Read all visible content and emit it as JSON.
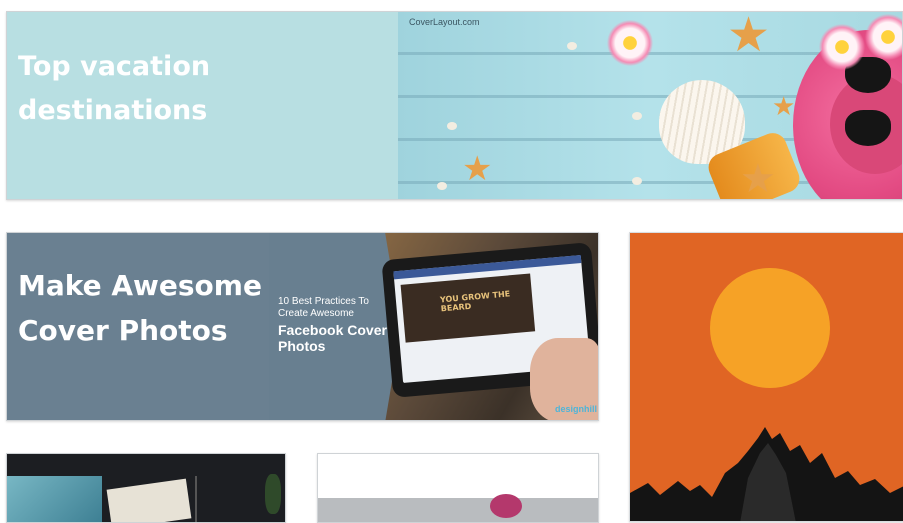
{
  "cards": [
    {
      "id": "beach",
      "headline_line1": "Top vacation",
      "headline_line2": "destinations",
      "credit": "CoverLayout.com",
      "bg_color": "#b8dfe2"
    },
    {
      "id": "facebook",
      "headline_line1": "Make Awesome",
      "headline_line2": "Cover Photos",
      "sub_small": "10 Best Practices To Create Awesome",
      "sub_large": "Facebook Cover Photos",
      "screen_text": "YOU GROW THE BEARD",
      "logo": "designhill",
      "bg_color": "#6a8091"
    },
    {
      "id": "sunset",
      "bg_color": "#e06524",
      "sun_color": "#f6a226"
    },
    {
      "id": "photo-collage",
      "bg_color": "#1c1e22"
    },
    {
      "id": "white-card",
      "bg_color": "#ffffff"
    }
  ],
  "icons": [
    "starfish-icon",
    "seashell-icon",
    "flower-icon",
    "sunglasses-icon",
    "tablet-icon",
    "hand-icon",
    "sun-icon",
    "mountain-icon"
  ]
}
